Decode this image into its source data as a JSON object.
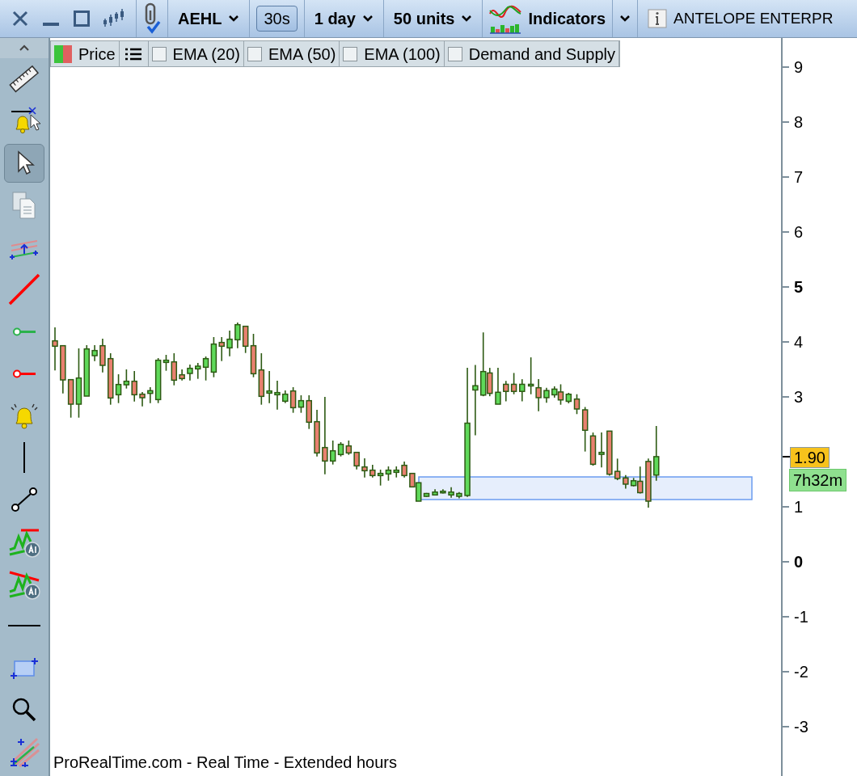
{
  "toolbar": {
    "symbol": "AEHL",
    "interval": "30s",
    "period": "1 day",
    "units": "50 units",
    "indicators": "Indicators",
    "company": "ANTELOPE ENTERPR"
  },
  "tools": [
    {
      "kind": "ruler",
      "selected": false
    },
    {
      "kind": "alert-cursor",
      "selected": false
    },
    {
      "kind": "pointer",
      "selected": true
    },
    {
      "kind": "copy",
      "selected": false
    },
    {
      "kind": "channel",
      "selected": false
    },
    {
      "kind": "line",
      "selected": false
    },
    {
      "kind": "green-ray",
      "selected": false
    },
    {
      "kind": "red-ray",
      "selected": false
    },
    {
      "kind": "bell",
      "selected": false
    },
    {
      "kind": "vertical-line",
      "selected": false
    },
    {
      "kind": "segment",
      "selected": false
    },
    {
      "kind": "ai-up",
      "selected": false
    },
    {
      "kind": "ai-down",
      "selected": false
    },
    {
      "kind": "horizontal-line",
      "selected": false
    },
    {
      "kind": "rectangle",
      "selected": false
    },
    {
      "kind": "zoom",
      "selected": false
    },
    {
      "kind": "fan",
      "selected": false
    }
  ],
  "legend": {
    "price": "Price",
    "checkboxes": [
      {
        "label": "EMA (20)",
        "checked": false
      },
      {
        "label": "EMA (50)",
        "checked": false
      },
      {
        "label": "EMA (100)",
        "checked": false
      },
      {
        "label": "Demand and Supply",
        "checked": false
      }
    ]
  },
  "axis": {
    "ticks": [
      {
        "label": "9",
        "bold": false
      },
      {
        "label": "8",
        "bold": false
      },
      {
        "label": "7",
        "bold": false
      },
      {
        "label": "6",
        "bold": false
      },
      {
        "label": "5",
        "bold": true
      },
      {
        "label": "4",
        "bold": false
      },
      {
        "label": "3",
        "bold": false
      },
      {
        "label": "1",
        "bold": false
      },
      {
        "label": "0",
        "bold": true
      },
      {
        "label": "-1",
        "bold": false
      },
      {
        "label": "-2",
        "bold": false
      },
      {
        "label": "-3",
        "bold": false
      }
    ],
    "price_label": "1.90",
    "timer": "7h32m"
  },
  "footer": "ProRealTime.com - Real Time - Extended hours"
}
